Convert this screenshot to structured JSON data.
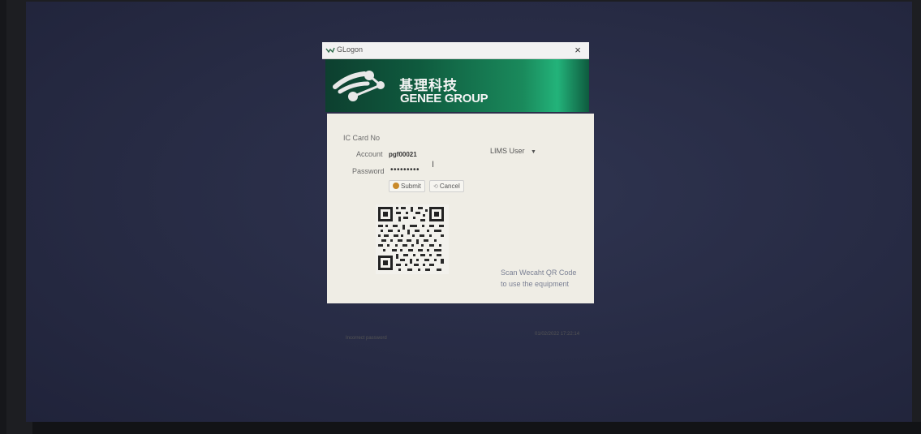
{
  "window": {
    "title": "GLogon",
    "close": "×"
  },
  "banner": {
    "cn": "基理科技",
    "en": "GENEE GROUP"
  },
  "form": {
    "ic_card_label": "IC Card No",
    "account_label": "Account",
    "account_value": "pgf00021",
    "password_label": "Password",
    "password_value": "•••••••••",
    "user_type": "LIMS User",
    "submit_label": "Submit",
    "cancel_label": "Cancel"
  },
  "qr": {
    "text_line1": "Scan Wecaht QR Code",
    "text_line2": "to use the equipment"
  },
  "status": {
    "message": "Incorrect password",
    "timestamp": "01/02/2022 17:22:14"
  }
}
